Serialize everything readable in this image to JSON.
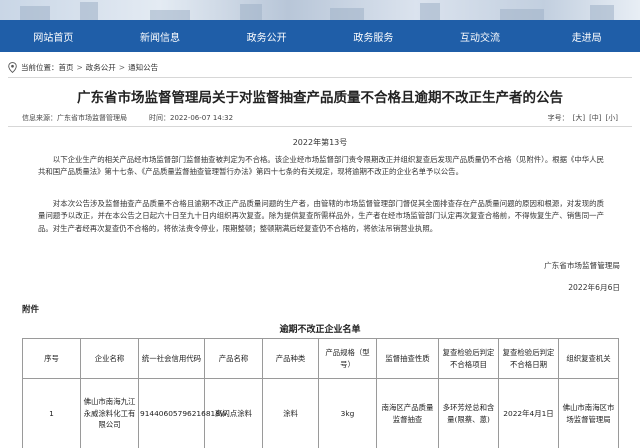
{
  "nav": {
    "items": [
      "网站首页",
      "新闻信息",
      "政务公开",
      "政务服务",
      "互动交流",
      "走进局"
    ]
  },
  "breadcrumb": {
    "label": "当前位置：",
    "items": [
      "首页",
      "政务公开",
      "通知公告"
    ],
    "separator": ">"
  },
  "article": {
    "title": "广东省市场监督管理局关于对监督抽查产品质量不合格且逾期不改正生产者的公告",
    "source_label": "信息来源：广东省市场监督管理局",
    "date_label": "时间：2022-06-07 14:32",
    "font_size_label": "字号：",
    "font_sizes": [
      "[大]",
      "[中]",
      "[小]"
    ],
    "doc_number": "2022年第13号",
    "paragraph1": "以下企业生产的相关产品经市场监督部门监督抽查被判定为不合格。该企业经市场监督部门责令限期改正并组织复查后发现产品质量仍不合格（见附件）。根据《中华人民共和国产品质量法》第十七条、《产品质量监督抽查管理暂行办法》第四十七条的有关规定，现将逾期不改正的企业名单予以公告。",
    "paragraph2": "对本次公告涉及监督抽查产品质量不合格且逾期不改正产品质量问题的生产者，由管辖的市场监督管理部门督促其全面排查存在产品质量问题的原因和根源，对发现的质量问题予以改正，并在本公告之日起六十日至九十日内组织再次复查。除为提供复查所需样品外，生产者在经市场监管部门认定再次复查合格前，不得恢复生产、销售同一产品。对生产者经再次复查仍不合格的，将依法责令停业，限期整顿；整顿期满后经复查仍不合格的，将依法吊销营业执照。",
    "signature_org": "广东省市场监督管理局",
    "signature_date": "2022年6月6日",
    "attachment_label": "附件"
  },
  "table": {
    "title": "逾期不改正企业名单",
    "headers": [
      "序号",
      "企业名称",
      "统一社会信用代码",
      "产品名称",
      "产品种类",
      "产品规格（型号）",
      "监督抽查性质",
      "复查检验后判定不合格项目",
      "复查检验后判定不合格日期",
      "组织复查机关"
    ],
    "rows": [
      [
        "1",
        "佛山市南海九江永威涂料化工有限公司",
        "91440605796216818W",
        "高闪点涂料",
        "涂料",
        "3kg",
        "南海区产品质量监督抽查",
        "多环芳烃总和含量(限蔡、蒽)",
        "2022年4月1日",
        "佛山市南海区市场监督管理局"
      ]
    ]
  },
  "colors": {
    "nav_bg": "#1f5ea8",
    "title_text": "#222222"
  }
}
